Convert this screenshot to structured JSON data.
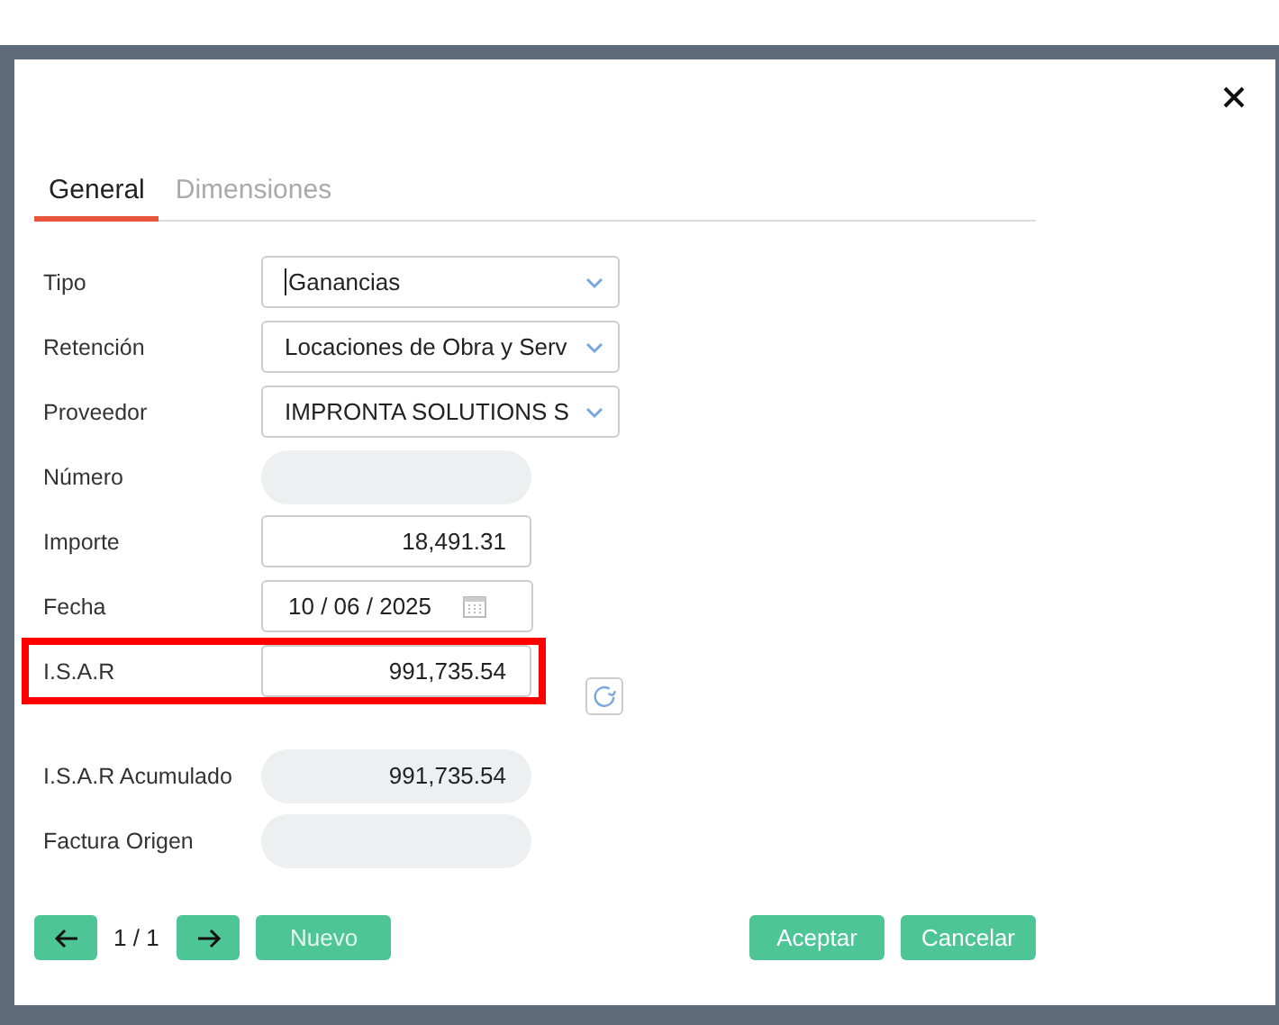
{
  "dialog": {
    "tabs": [
      {
        "label": "General",
        "selected": true
      },
      {
        "label": "Dimensiones",
        "selected": false
      }
    ],
    "fields": [
      {
        "label": "Tipo",
        "kind": "select",
        "value": "Ganancias",
        "focused": true
      },
      {
        "label": "Retención",
        "kind": "select",
        "value": "Locaciones de Obra y Serv"
      },
      {
        "label": "Proveedor",
        "kind": "select",
        "value": "IMPRONTA SOLUTIONS S"
      },
      {
        "label": "Número",
        "kind": "readonly"
      },
      {
        "label": "Importe",
        "kind": "input",
        "value": "18,491.31"
      },
      {
        "label": "Fecha",
        "kind": "date",
        "value": "10 / 06 / 2025"
      },
      {
        "label": "I.S.A.R",
        "kind": "input",
        "value": "991,735.54",
        "highlighted": true,
        "refresh": true
      },
      {
        "label": "I.S.A.R Acumulado",
        "kind": "readonly",
        "value": "991,735.54"
      },
      {
        "label": "Factura Origen",
        "kind": "readonly"
      }
    ],
    "pager": "1 / 1",
    "buttons": {
      "new": "Nuevo",
      "accept": "Aceptar",
      "cancel": "Cancelar"
    }
  }
}
